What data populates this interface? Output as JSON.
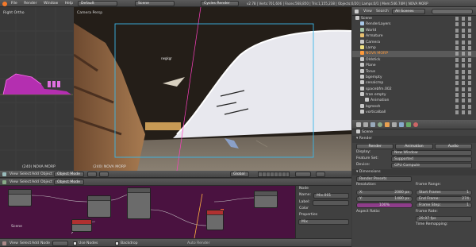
{
  "topbar": {
    "menus": [
      "File",
      "Render",
      "Window",
      "Help"
    ],
    "screen_layout": "Default",
    "scene": "Scene",
    "engine": "Cycles Render",
    "stats": "v2.78 | Verts:701,606 | Faces:568,850 | Tris:1,155,238 | Objects:0/20 | Lamps:0/1 | Mem:546.74M | NOVA MORP"
  },
  "left_view": {
    "label": "Right Ortho",
    "status": "(240) NOVA MORP"
  },
  "cam_view": {
    "label": "Camera Persp",
    "status": "(240) NOVA MORP",
    "blob_text": "rwgkgr"
  },
  "view_header": {
    "items": [
      "View",
      "Select",
      "Add",
      "Object"
    ],
    "mode": "Object Mode",
    "pivot": "Global"
  },
  "outliner": {
    "header": [
      "View",
      "Search",
      "All Scenes"
    ],
    "items": [
      {
        "label": "Scene",
        "color": "#c8c8c8",
        "indent": 0,
        "highlight": false
      },
      {
        "label": "RenderLayers",
        "color": "#a8c8e8",
        "indent": 1,
        "highlight": false
      },
      {
        "label": "World",
        "color": "#a8c8a8",
        "indent": 1,
        "highlight": false
      },
      {
        "label": "Armature",
        "color": "#e8c070",
        "indent": 1,
        "highlight": false
      },
      {
        "label": "Camera",
        "color": "#c8c8c8",
        "indent": 1,
        "highlight": false
      },
      {
        "label": "Lamp",
        "color": "#f0e080",
        "indent": 1,
        "highlight": false
      },
      {
        "label": "NOVA MORP",
        "color": "#ff9a3a",
        "indent": 1,
        "highlight": true
      },
      {
        "label": "Oldstick",
        "color": "#c8c8c8",
        "indent": 1,
        "highlight": false
      },
      {
        "label": "Plane",
        "color": "#c8c8c8",
        "indent": 1,
        "highlight": false
      },
      {
        "label": "Torus",
        "color": "#c8c8c8",
        "indent": 1,
        "highlight": false
      },
      {
        "label": "bgempty",
        "color": "#c8c8c8",
        "indent": 1,
        "highlight": false
      },
      {
        "label": "cenalcmp",
        "color": "#c8c8c8",
        "indent": 1,
        "highlight": false
      },
      {
        "label": "spacebfm.002",
        "color": "#c8c8c8",
        "indent": 1,
        "highlight": false
      },
      {
        "label": "tran empty",
        "color": "#c8c8c8",
        "indent": 1,
        "highlight": false
      },
      {
        "label": "Animation",
        "color": "#c8c8c8",
        "indent": 2,
        "highlight": false
      },
      {
        "label": "bgmesh",
        "color": "#c8c8c8",
        "indent": 1,
        "highlight": false
      },
      {
        "label": "vorticalball",
        "color": "#c8c8c8",
        "indent": 1,
        "highlight": false
      }
    ]
  },
  "properties": {
    "breadcrumb": "Scene",
    "render_title": "Render",
    "render_buttons": [
      "Render",
      "Animation",
      "Audio"
    ],
    "fields": [
      {
        "label": "Display:",
        "value": "New Window"
      },
      {
        "label": "Feature Set:",
        "value": "Supported"
      },
      {
        "label": "Device:",
        "value": "GPU Compute"
      }
    ],
    "dimensions_title": "Dimensions",
    "render_presets": "Render Presets",
    "resolution_label": "Resolution:",
    "res_x": {
      "label": "X:",
      "value": "2080 px"
    },
    "res_y": {
      "label": "Y:",
      "value": "1480 px"
    },
    "res_pct": "100%",
    "aspect_label": "Aspect Ratio:",
    "frame_range_label": "Frame Range:",
    "start_frame": {
      "label": "Start Frame:",
      "value": "1"
    },
    "end_frame": {
      "label": "End Frame:",
      "value": "274"
    },
    "frame_step": {
      "label": "Frame Step:",
      "value": "1"
    },
    "frame_rate_label": "Frame Rate:",
    "frame_rate": "29.97 fps",
    "time_remap": "Time Remapping:"
  },
  "node_header": {
    "items": [
      "View",
      "Select",
      "Add",
      "Object"
    ],
    "mode": "Object Mode"
  },
  "node_sidebar": {
    "title": "Node",
    "name_label": "Name:",
    "name_value": "Mix.001",
    "label_label": "Label:",
    "color_label": "Color",
    "properties_label": "Properties",
    "mix_value": "Mix"
  },
  "node_footer": {
    "items": [
      "View",
      "Select",
      "Add",
      "Node"
    ],
    "use_nodes": "Use Nodes",
    "backdrop": "Backdrop",
    "auto_render": "Auto Render"
  },
  "node_editor": {
    "scene_label": "Scene"
  }
}
